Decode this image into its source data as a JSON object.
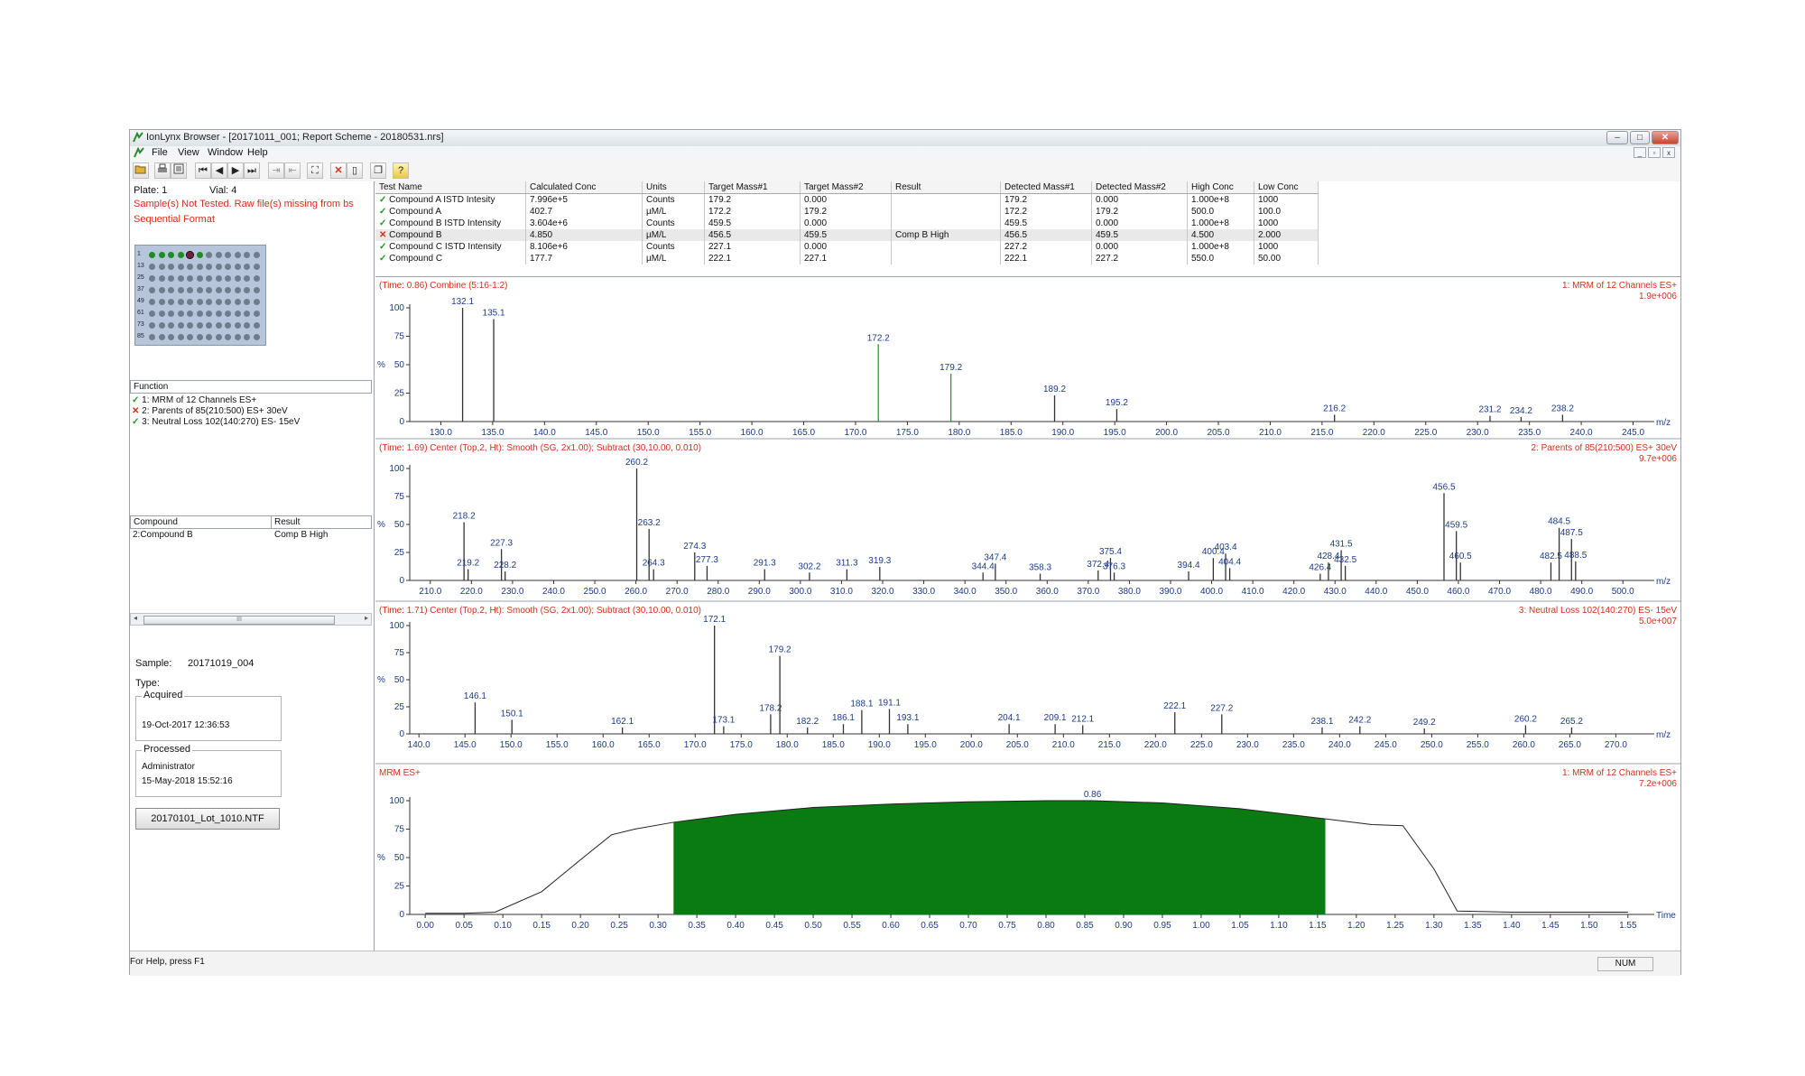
{
  "window": {
    "title": "IonLynx Browser - [20171011_001; Report Scheme - 20180531.nrs]",
    "min": "–",
    "restore": "□",
    "close": "✕"
  },
  "menu": [
    "File",
    "View",
    "Window",
    "Help"
  ],
  "left": {
    "plate": "Plate: 1",
    "vial": "Vial: 4",
    "warning": "Sample(s) Not Tested. Raw file(s) missing from bs",
    "format": "Sequential Format",
    "row_labels": [
      "1",
      "13",
      "25",
      "37",
      "49",
      "61",
      "73",
      "85"
    ],
    "function_header": "Function",
    "functions": [
      {
        "status": "ok",
        "label": "1: MRM of 12 Channels ES+"
      },
      {
        "status": "fail",
        "label": "2: Parents of 85(210:500) ES+ 30eV"
      },
      {
        "status": "ok",
        "label": "3: Neutral Loss 102(140:270) ES- 15eV"
      }
    ],
    "compound_header": "Compound",
    "result_header": "Result",
    "compound_row": {
      "compound": "2:Compound B",
      "result": "Comp B High"
    },
    "scroll_grip": "III",
    "sample_label": "Sample:",
    "sample_value": "20171019_004",
    "type_label": "Type:",
    "acquired_label": "Acquired",
    "acquired_value": "19-Oct-2017 12:36:53",
    "processed_label": "Processed",
    "processed_user": "Administrator",
    "processed_date": "15-May-2018 15:52:16",
    "file_button": "20170101_Lot_1010.NTF"
  },
  "table": {
    "headers": [
      "Test Name",
      "Calculated Conc",
      "Units",
      "Target Mass#1",
      "Target Mass#2",
      "Result",
      "Detected Mass#1",
      "Detected Mass#2",
      "High Conc",
      "Low Conc"
    ],
    "rows": [
      {
        "status": "ok",
        "cells": [
          "Compound A ISTD Intesity",
          "7.996e+5",
          "Counts",
          "179.2",
          "0.000",
          "",
          "179.2",
          "0.000",
          "1.000e+8",
          "1000"
        ]
      },
      {
        "status": "ok",
        "cells": [
          "Compound A",
          "402.7",
          "µM/L",
          "172.2",
          "179.2",
          "",
          "172.2",
          "179.2",
          "500.0",
          "100.0"
        ]
      },
      {
        "status": "ok",
        "cells": [
          "Compound B ISTD Intensity",
          "3.604e+6",
          "Counts",
          "459.5",
          "0.000",
          "",
          "459.5",
          "0.000",
          "1.000e+8",
          "1000"
        ]
      },
      {
        "status": "fail",
        "cells": [
          "Compound B",
          "4.850",
          "µM/L",
          "456.5",
          "459.5",
          "Comp B High",
          "456.5",
          "459.5",
          "4.500",
          "2.000"
        ]
      },
      {
        "status": "ok",
        "cells": [
          "Compound C ISTD Intensity",
          "8.106e+6",
          "Counts",
          "227.1",
          "0.000",
          "",
          "227.2",
          "0.000",
          "1.000e+8",
          "1000"
        ]
      },
      {
        "status": "ok",
        "cells": [
          "Compound C",
          "177.7",
          "µM/L",
          "222.1",
          "227.1",
          "",
          "222.1",
          "227.2",
          "550.0",
          "50.00"
        ]
      }
    ]
  },
  "status": {
    "help": "For Help, press F1",
    "num": "NUM"
  },
  "chart_data": [
    {
      "type": "bar",
      "title_left": "(Time: 0.86) Combine (5:16-1:2)",
      "title_right": "1: MRM of 12 Channels ES+",
      "intensity": "1.9e+006",
      "xlabel": "m/z",
      "ylabel": "%",
      "xlim": [
        127,
        246
      ],
      "xticks": [
        130.0,
        135.0,
        140.0,
        145.0,
        150.0,
        155.0,
        160.0,
        165.0,
        170.0,
        175.0,
        180.0,
        185.0,
        190.0,
        195.0,
        200.0,
        205.0,
        210.0,
        215.0,
        220.0,
        225.0,
        230.0,
        235.0,
        240.0,
        245.0
      ],
      "yticks": [
        0,
        25,
        50,
        75,
        100
      ],
      "peaks": [
        {
          "x": 132.1,
          "y": 100,
          "label": "132.1",
          "color": "#333"
        },
        {
          "x": 135.1,
          "y": 90,
          "label": "135.1",
          "color": "#333"
        },
        {
          "x": 172.2,
          "y": 68,
          "label": "172.2",
          "color": "#2a9a2a"
        },
        {
          "x": 179.2,
          "y": 42,
          "label": "179.2",
          "color": "#2a9a2a"
        },
        {
          "x": 189.2,
          "y": 23,
          "label": "189.2",
          "color": "#333"
        },
        {
          "x": 195.2,
          "y": 11,
          "label": "195.2",
          "color": "#333"
        },
        {
          "x": 216.2,
          "y": 6,
          "label": "216.2",
          "color": "#333"
        },
        {
          "x": 231.2,
          "y": 5,
          "label": "231.2",
          "color": "#333"
        },
        {
          "x": 234.2,
          "y": 4,
          "label": "234.2",
          "color": "#333"
        },
        {
          "x": 238.2,
          "y": 6,
          "label": "238.2",
          "color": "#333"
        }
      ]
    },
    {
      "type": "bar",
      "title_left": "(Time: 1.69) Center (Top,2, Ht): Smooth (SG, 2x1.00); Subtract (30,10.00, 0.010)",
      "title_right": "2: Parents of 85(210:500) ES+ 30eV",
      "intensity": "9.7e+006",
      "xlabel": "m/z",
      "ylabel": "%",
      "xlim": [
        205,
        505
      ],
      "xticks": [
        210.0,
        220.0,
        230.0,
        240.0,
        250.0,
        260.0,
        270.0,
        280.0,
        290.0,
        300.0,
        310.0,
        320.0,
        330.0,
        340.0,
        350.0,
        360.0,
        370.0,
        380.0,
        390.0,
        400.0,
        410.0,
        420.0,
        430.0,
        440.0,
        450.0,
        460.0,
        470.0,
        480.0,
        490.0,
        500.0
      ],
      "yticks": [
        0,
        25,
        50,
        75,
        100
      ],
      "peaks": [
        {
          "x": 218.2,
          "y": 52,
          "label": "218.2",
          "color": "#333"
        },
        {
          "x": 219.2,
          "y": 10,
          "label": "219.2",
          "color": "#333"
        },
        {
          "x": 227.3,
          "y": 28,
          "label": "227.3",
          "color": "#333"
        },
        {
          "x": 228.2,
          "y": 8,
          "label": "228.2",
          "color": "#333"
        },
        {
          "x": 260.2,
          "y": 100,
          "label": "260.2",
          "color": "#333"
        },
        {
          "x": 263.2,
          "y": 46,
          "label": "263.2",
          "color": "#333"
        },
        {
          "x": 264.3,
          "y": 10,
          "label": "264.3",
          "color": "#333"
        },
        {
          "x": 274.3,
          "y": 25,
          "label": "274.3",
          "color": "#333"
        },
        {
          "x": 277.3,
          "y": 13,
          "label": "277.3",
          "color": "#333"
        },
        {
          "x": 291.3,
          "y": 10,
          "label": "291.3",
          "color": "#333"
        },
        {
          "x": 302.2,
          "y": 7,
          "label": "302.2",
          "color": "#333"
        },
        {
          "x": 311.3,
          "y": 10,
          "label": "311.3",
          "color": "#333"
        },
        {
          "x": 319.3,
          "y": 12,
          "label": "319.3",
          "color": "#333"
        },
        {
          "x": 344.4,
          "y": 7,
          "label": "344.4",
          "color": "#333"
        },
        {
          "x": 347.4,
          "y": 15,
          "label": "347.4",
          "color": "#333"
        },
        {
          "x": 358.3,
          "y": 6,
          "label": "358.3",
          "color": "#333"
        },
        {
          "x": 372.4,
          "y": 9,
          "label": "372.4",
          "color": "#333"
        },
        {
          "x": 375.4,
          "y": 20,
          "label": "375.4",
          "color": "#333"
        },
        {
          "x": 376.3,
          "y": 7,
          "label": "376.3",
          "color": "#333"
        },
        {
          "x": 394.4,
          "y": 8,
          "label": "394.4",
          "color": "#333"
        },
        {
          "x": 400.4,
          "y": 20,
          "label": "400.4",
          "color": "#333"
        },
        {
          "x": 403.4,
          "y": 24,
          "label": "403.4",
          "color": "#333"
        },
        {
          "x": 404.4,
          "y": 11,
          "label": "404.4",
          "color": "#333"
        },
        {
          "x": 426.4,
          "y": 6,
          "label": "426.4",
          "color": "#333"
        },
        {
          "x": 428.4,
          "y": 16,
          "label": "428.4",
          "color": "#333"
        },
        {
          "x": 431.5,
          "y": 27,
          "label": "431.5",
          "color": "#333"
        },
        {
          "x": 432.5,
          "y": 13,
          "label": "432.5",
          "color": "#333"
        },
        {
          "x": 456.5,
          "y": 78,
          "label": "456.5",
          "color": "#333"
        },
        {
          "x": 459.5,
          "y": 44,
          "label": "459.5",
          "color": "#333"
        },
        {
          "x": 460.5,
          "y": 16,
          "label": "460.5",
          "color": "#333"
        },
        {
          "x": 482.5,
          "y": 16,
          "label": "482.5",
          "color": "#333"
        },
        {
          "x": 484.5,
          "y": 47,
          "label": "484.5",
          "color": "#333"
        },
        {
          "x": 487.5,
          "y": 37,
          "label": "487.5",
          "color": "#333"
        },
        {
          "x": 488.5,
          "y": 17,
          "label": "488.5",
          "color": "#333"
        }
      ]
    },
    {
      "type": "bar",
      "title_left": "(Time: 1.71) Center (Top,2, Ht): Smooth (SG, 2x1.00); Subtract (30,10.00, 0.010)",
      "title_right": "3: Neutral Loss 102(140:270) ES- 15eV",
      "intensity": "5.0e+007",
      "xlabel": "m/z",
      "ylabel": "%",
      "xlim": [
        139,
        273
      ],
      "xticks": [
        140.0,
        145.0,
        150.0,
        155.0,
        160.0,
        165.0,
        170.0,
        175.0,
        180.0,
        185.0,
        190.0,
        195.0,
        200.0,
        205.0,
        210.0,
        215.0,
        220.0,
        225.0,
        230.0,
        235.0,
        240.0,
        245.0,
        250.0,
        255.0,
        260.0,
        265.0,
        270.0
      ],
      "yticks": [
        0,
        25,
        50,
        75,
        100
      ],
      "peaks": [
        {
          "x": 146.1,
          "y": 29,
          "label": "146.1",
          "color": "#333"
        },
        {
          "x": 150.1,
          "y": 13,
          "label": "150.1",
          "color": "#333"
        },
        {
          "x": 162.1,
          "y": 6,
          "label": "162.1",
          "color": "#333"
        },
        {
          "x": 172.1,
          "y": 100,
          "label": "172.1",
          "color": "#333"
        },
        {
          "x": 173.1,
          "y": 7,
          "label": "173.1",
          "color": "#333"
        },
        {
          "x": 178.2,
          "y": 18,
          "label": "178.2",
          "color": "#333"
        },
        {
          "x": 179.2,
          "y": 72,
          "label": "179.2",
          "color": "#333"
        },
        {
          "x": 182.2,
          "y": 6,
          "label": "182.2",
          "color": "#333"
        },
        {
          "x": 186.1,
          "y": 9,
          "label": "186.1",
          "color": "#333"
        },
        {
          "x": 188.1,
          "y": 22,
          "label": "188.1",
          "color": "#333"
        },
        {
          "x": 191.1,
          "y": 23,
          "label": "191.1",
          "color": "#333"
        },
        {
          "x": 193.1,
          "y": 9,
          "label": "193.1",
          "color": "#333"
        },
        {
          "x": 204.1,
          "y": 9,
          "label": "204.1",
          "color": "#333"
        },
        {
          "x": 209.1,
          "y": 9,
          "label": "209.1",
          "color": "#333"
        },
        {
          "x": 212.1,
          "y": 8,
          "label": "212.1",
          "color": "#333"
        },
        {
          "x": 222.1,
          "y": 20,
          "label": "222.1",
          "color": "#333"
        },
        {
          "x": 227.2,
          "y": 18,
          "label": "227.2",
          "color": "#333"
        },
        {
          "x": 238.1,
          "y": 6,
          "label": "238.1",
          "color": "#333"
        },
        {
          "x": 242.2,
          "y": 7,
          "label": "242.2",
          "color": "#333"
        },
        {
          "x": 249.2,
          "y": 5,
          "label": "249.2",
          "color": "#333"
        },
        {
          "x": 260.2,
          "y": 8,
          "label": "260.2",
          "color": "#333"
        },
        {
          "x": 265.2,
          "y": 6,
          "label": "265.2",
          "color": "#333"
        }
      ]
    },
    {
      "type": "area",
      "title_left": "MRM ES+",
      "title_right": "1: MRM of 12 Channels ES+",
      "intensity": "7.2e+006",
      "xlabel": "Time",
      "ylabel": "%",
      "xlim": [
        -0.02,
        1.57
      ],
      "xticks": [
        -0.0,
        0.05,
        0.1,
        0.15,
        0.2,
        0.25,
        0.3,
        0.35,
        0.4,
        0.45,
        0.5,
        0.55,
        0.6,
        0.65,
        0.7,
        0.75,
        0.8,
        0.85,
        0.9,
        0.95,
        1.0,
        1.05,
        1.1,
        1.15,
        1.2,
        1.25,
        1.3,
        1.35,
        1.4,
        1.45,
        1.5,
        1.55
      ],
      "yticks": [
        0,
        25,
        50,
        75,
        100
      ],
      "apex_label": "0.86",
      "fill_color": "#0a7a12",
      "fill_range": [
        0.32,
        1.16
      ],
      "x": [
        0.0,
        0.05,
        0.09,
        0.15,
        0.2,
        0.24,
        0.27,
        0.32,
        0.4,
        0.5,
        0.6,
        0.7,
        0.8,
        0.86,
        0.95,
        1.05,
        1.16,
        1.22,
        1.26,
        1.3,
        1.33,
        1.4,
        1.5,
        1.55
      ],
      "y": [
        1,
        1,
        2,
        20,
        48,
        70,
        75,
        81,
        88,
        94,
        97,
        99,
        100,
        100,
        98,
        93,
        84,
        79,
        78,
        40,
        3,
        2,
        2,
        2
      ]
    }
  ]
}
